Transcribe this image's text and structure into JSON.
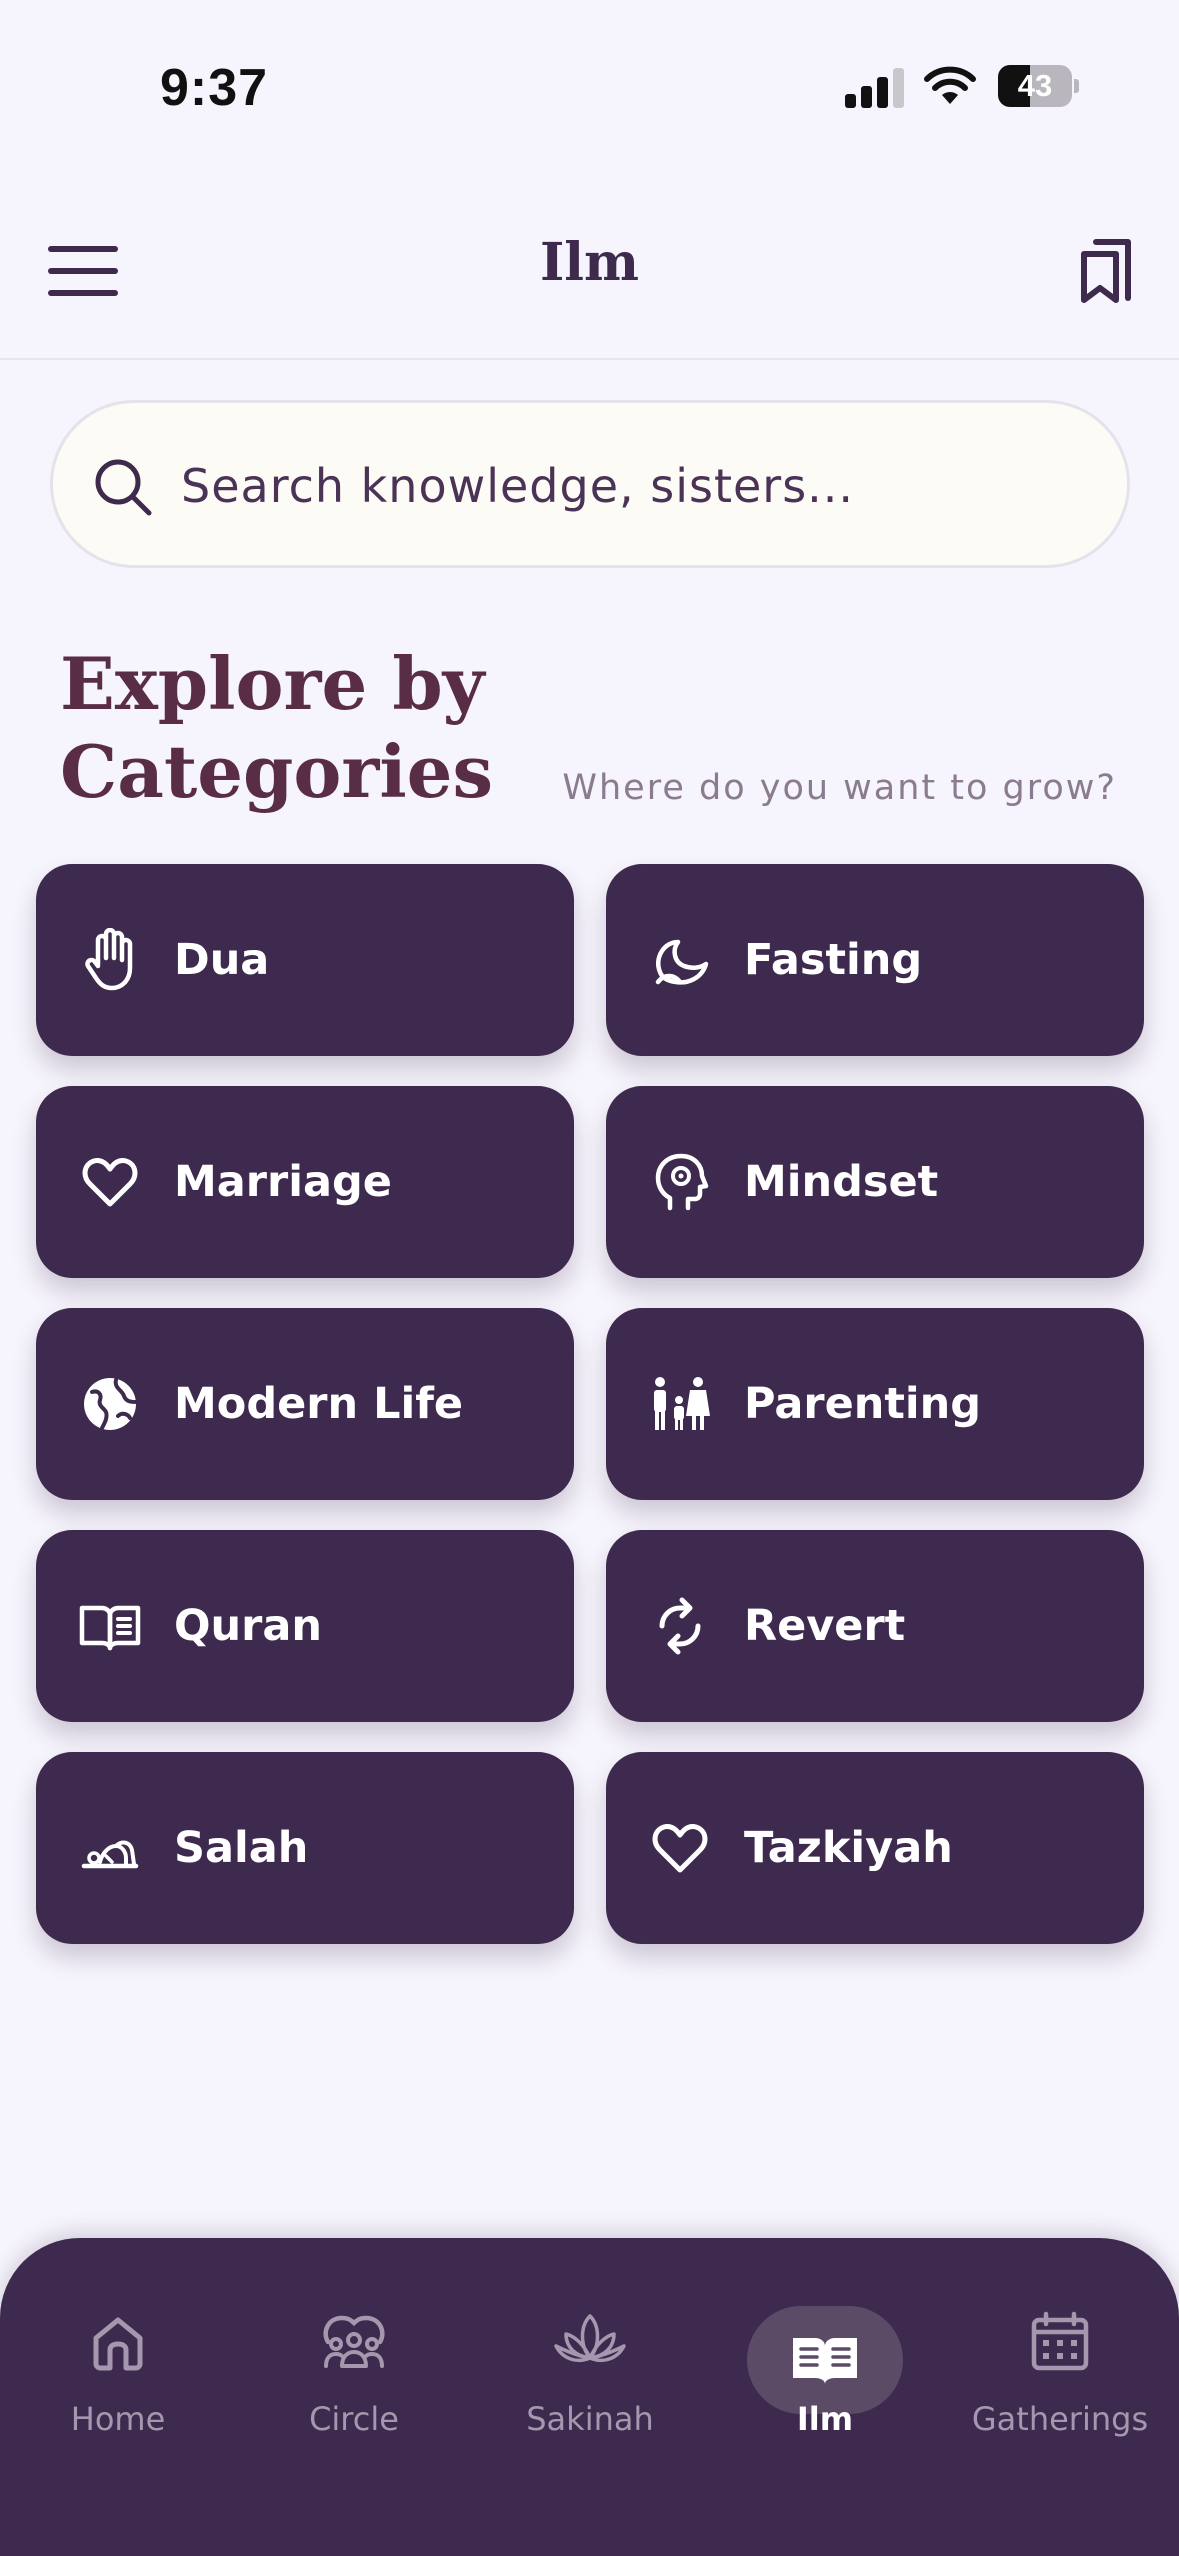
{
  "status": {
    "time": "9:37",
    "battery": "43",
    "battery_level": 0.43
  },
  "header": {
    "title": "Ilm"
  },
  "search": {
    "placeholder": "Search knowledge, sisters..."
  },
  "section": {
    "title": "Explore by Categories",
    "subtitle": "Where do you want to grow?"
  },
  "categories": [
    {
      "label": "Dua",
      "icon": "raised-hand-icon"
    },
    {
      "label": "Fasting",
      "icon": "crescent-moon-icon"
    },
    {
      "label": "Marriage",
      "icon": "heart-icon"
    },
    {
      "label": "Mindset",
      "icon": "head-gear-icon"
    },
    {
      "label": "Modern Life",
      "icon": "globe-icon"
    },
    {
      "label": "Parenting",
      "icon": "family-icon"
    },
    {
      "label": "Quran",
      "icon": "open-book-icon"
    },
    {
      "label": "Revert",
      "icon": "refresh-arrows-icon"
    },
    {
      "label": "Salah",
      "icon": "prayer-icon"
    },
    {
      "label": "Tazkiyah",
      "icon": "heart-icon"
    }
  ],
  "tabs": [
    {
      "label": "Home",
      "icon": "home-icon"
    },
    {
      "label": "Circle",
      "icon": "group-icon"
    },
    {
      "label": "Sakinah",
      "icon": "lotus-icon"
    },
    {
      "label": "Ilm",
      "icon": "open-book-icon",
      "active": true
    },
    {
      "label": "Gatherings",
      "icon": "calendar-icon"
    }
  ],
  "colors": {
    "primary": "#3e2a4e",
    "background": "#f6f4fc",
    "heading": "#5a2d47",
    "muted": "#8b7b8f"
  }
}
